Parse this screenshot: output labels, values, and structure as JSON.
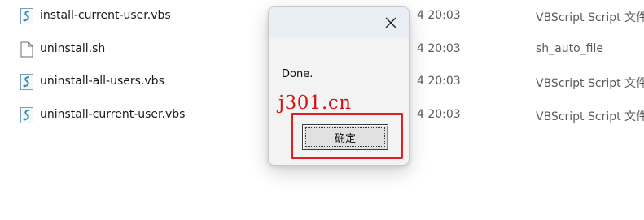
{
  "files": [
    {
      "name": "install-current-user.vbs",
      "date_fragment": "4 20:03",
      "type": "VBScript Script 文件",
      "icon": "vbs-file-icon"
    },
    {
      "name": "uninstall.sh",
      "date_fragment": "4 20:03",
      "type": "sh_auto_file",
      "icon": "generic-file-icon"
    },
    {
      "name": "uninstall-all-users.vbs",
      "date_fragment": "4 20:03",
      "type": "VBScript Script 文件",
      "icon": "vbs-file-icon"
    },
    {
      "name": "uninstall-current-user.vbs",
      "date_fragment": "4 20:03",
      "type": "VBScript Script 文件",
      "icon": "vbs-file-icon"
    }
  ],
  "dialog": {
    "message": "Done.",
    "ok_label": "确定"
  },
  "watermark": "j301.cn",
  "colors": {
    "highlight": "#e02020",
    "watermark": "#d21414",
    "titlebar": "#e8eef4"
  }
}
